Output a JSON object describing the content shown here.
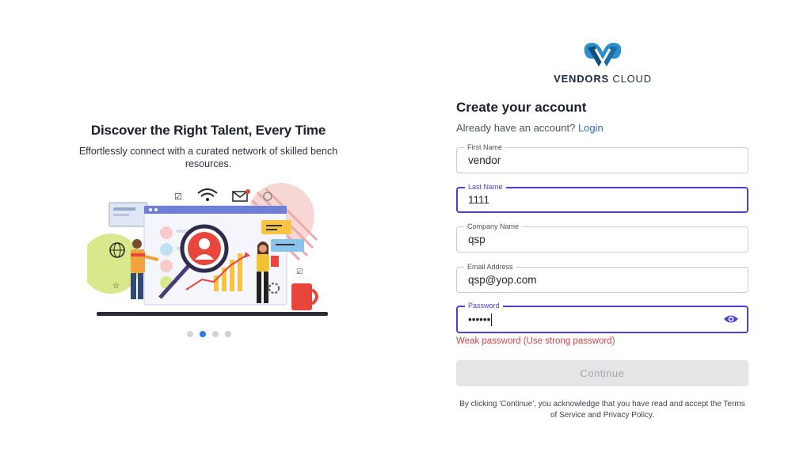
{
  "hero": {
    "title": "Discover the Right Talent, Every Time",
    "subtitle": "Effortlessly connect with a curated network of skilled bench resources.",
    "carousel": {
      "count": 4,
      "active": 1
    }
  },
  "logo": {
    "brand_bold": "VENDORS",
    "brand_light": " CLOUD"
  },
  "form": {
    "title": "Create your account",
    "login_prompt": "Already have an account?",
    "login_link": "Login",
    "fields": {
      "first_name": {
        "label": "First Name",
        "value": "vendor"
      },
      "last_name": {
        "label": "Last Name",
        "value": "1111"
      },
      "company_name": {
        "label": "Company Name",
        "value": "qsp"
      },
      "email": {
        "label": "Email Address",
        "value": "qsp@yop.com"
      },
      "password": {
        "label": "Password",
        "value": "••••••"
      }
    },
    "password_error": "Weak password (Use strong password)",
    "continue_label": "Continue",
    "terms_text": "By clicking 'Continue', you acknowledge that you have read and accept the Terms of Service and Privacy Policy."
  },
  "colors": {
    "accent": "#4a3fd6",
    "link": "#2b6cdf",
    "error": "#d64545",
    "logo": "#1b6fa8"
  },
  "icons": {
    "password_toggle": "eye-icon"
  }
}
